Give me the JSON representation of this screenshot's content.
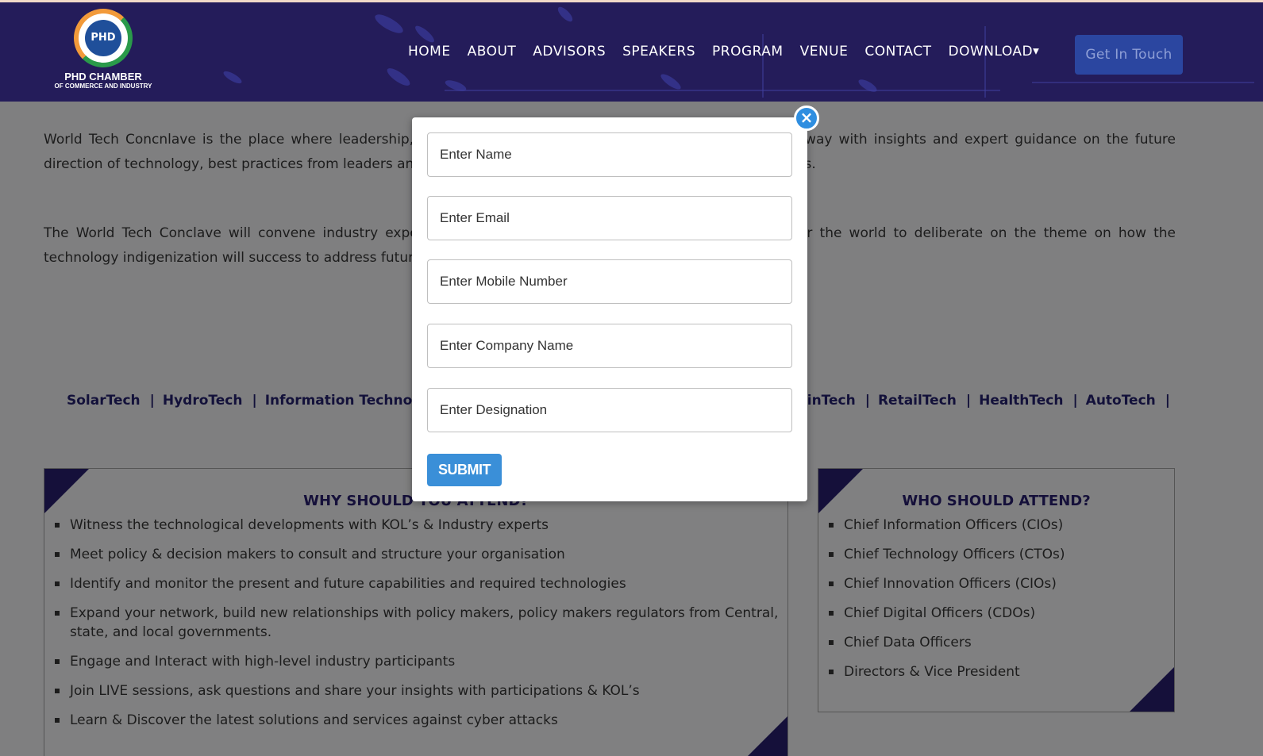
{
  "header": {
    "logo": {
      "emblem_text": "PHD",
      "name": "PHD CHAMBER",
      "subtitle": "OF COMMERCE AND INDUSTRY"
    },
    "nav": [
      {
        "label": "HOME"
      },
      {
        "label": "ABOUT"
      },
      {
        "label": "ADVISORS"
      },
      {
        "label": "SPEAKERS"
      },
      {
        "label": "PROGRAM"
      },
      {
        "label": "VENUE"
      },
      {
        "label": "CONTACT"
      },
      {
        "label": "DOWNLOAD"
      }
    ],
    "cta_label": "Get In Touch"
  },
  "content": {
    "paragraph1": "World Tech Concnlave is the place where leadership, innovation and technology converge. Attendees walk away with insights and expert guidance on the future direction of technology, best practices from leaders and real-world examples on how to execute on key initiatives.",
    "paragraph2": "The World Tech Conclave will convene industry experts, policy makers and other stakeholders from all over the world to deliberate on the theme on how the technology indigenization will success to address future challenges.",
    "tech_left": [
      "SolarTech",
      "HydroTech",
      "Information Technology"
    ],
    "tech_right": [
      "FinTech",
      "RetailTech",
      "HealthTech",
      "AutoTech"
    ],
    "why_card": {
      "title": "WHY SHOULD YOU ATTEND?",
      "items": [
        "Witness the technological developments with KOL’s & Industry experts",
        "Meet policy & decision makers to consult and structure your organisation",
        "Identify and monitor the present and future capabilities and required technologies",
        "Expand your network, build new relationships with policy makers, policy makers regulators from Central, state, and local governments.",
        "Engage and Interact with high-level industry participants",
        "Join LIVE sessions, ask questions and share your insights with participations & KOL’s",
        "Learn & Discover the latest solutions and services against cyber attacks"
      ]
    },
    "who_card": {
      "title": "WHO SHOULD ATTEND?",
      "items": [
        "Chief Information Officers (CIOs)",
        "Chief Technology Officers (CTOs)",
        "Chief Innovation Officers (CIOs)",
        "Chief Digital Officers (CDOs)",
        "Chief Data Officers",
        "Directors & Vice President"
      ]
    }
  },
  "modal": {
    "close_label": "×",
    "fields": {
      "name_placeholder": "Enter Name",
      "email_placeholder": "Enter Email",
      "mobile_placeholder": "Enter Mobile Number",
      "company_placeholder": "Enter Company Name",
      "designation_placeholder": "Enter Designation"
    },
    "submit_label": "SUBMIT"
  },
  "colors": {
    "header_bg": "#241c5a",
    "overlay_bg": "#7f7f80",
    "accent_blue": "#3a8fd8",
    "cta_bg": "#2b46a0",
    "dark_navy": "#15103a"
  }
}
